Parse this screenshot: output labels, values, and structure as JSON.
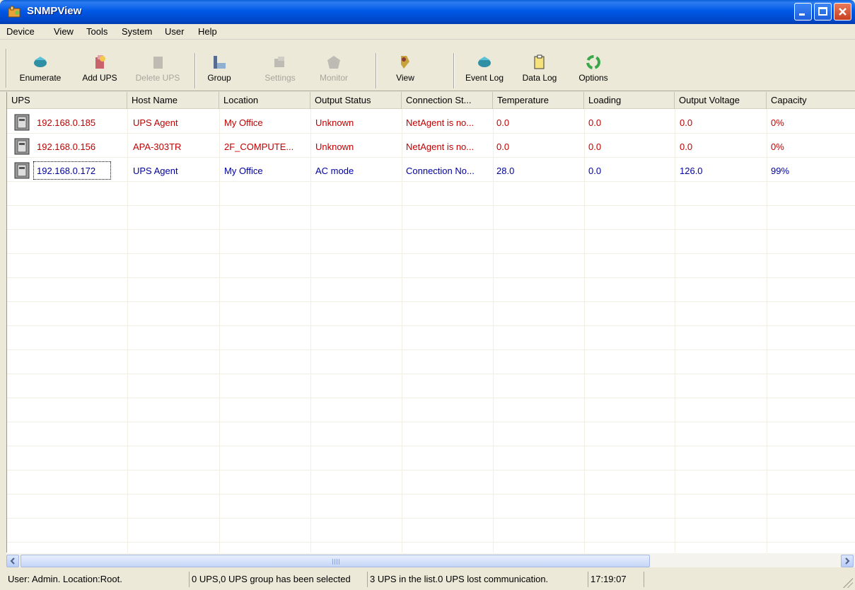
{
  "window": {
    "title": "SNMPView"
  },
  "menu": [
    "Device",
    "View",
    "Tools",
    "System",
    "User",
    "Help"
  ],
  "toolbar": {
    "enumerate": "Enumerate",
    "add_ups": "Add UPS",
    "delete_ups": "Delete UPS",
    "group": "Group",
    "settings": "Settings",
    "monitor": "Monitor",
    "view": "View",
    "event_log": "Event Log",
    "data_log": "Data Log",
    "options": "Options"
  },
  "table": {
    "columns": [
      "UPS",
      "Host Name",
      "Location",
      "Output Status",
      "Connection St...",
      "Temperature",
      "Loading",
      "Output Voltage",
      "Capacity"
    ],
    "rows": [
      {
        "status": "red",
        "cells": [
          "192.168.0.185",
          "UPS Agent",
          "My Office",
          "Unknown",
          "NetAgent is no...",
          "0.0",
          "0.0",
          "0.0",
          "0%"
        ]
      },
      {
        "status": "red",
        "cells": [
          "192.168.0.156",
          "APA-303TR",
          "2F_COMPUTE...",
          "Unknown",
          "NetAgent is no...",
          "0.0",
          "0.0",
          "0.0",
          "0%"
        ]
      },
      {
        "status": "blue",
        "cells": [
          "192.168.0.172",
          "UPS Agent",
          "My Office",
          "AC mode",
          "Connection No...",
          "28.0",
          "0.0",
          "126.0",
          "99%"
        ]
      }
    ]
  },
  "statusbar": {
    "user": "User: Admin.  Location:Root.",
    "selection": "0 UPS,0 UPS group has been selected",
    "list_info": "3 UPS in the list.0 UPS  lost communication.",
    "time": "17:19:07"
  },
  "colors": {
    "offline_row": "#c00000",
    "online_row": "#0000a0",
    "titlebar": "#0058e6"
  }
}
